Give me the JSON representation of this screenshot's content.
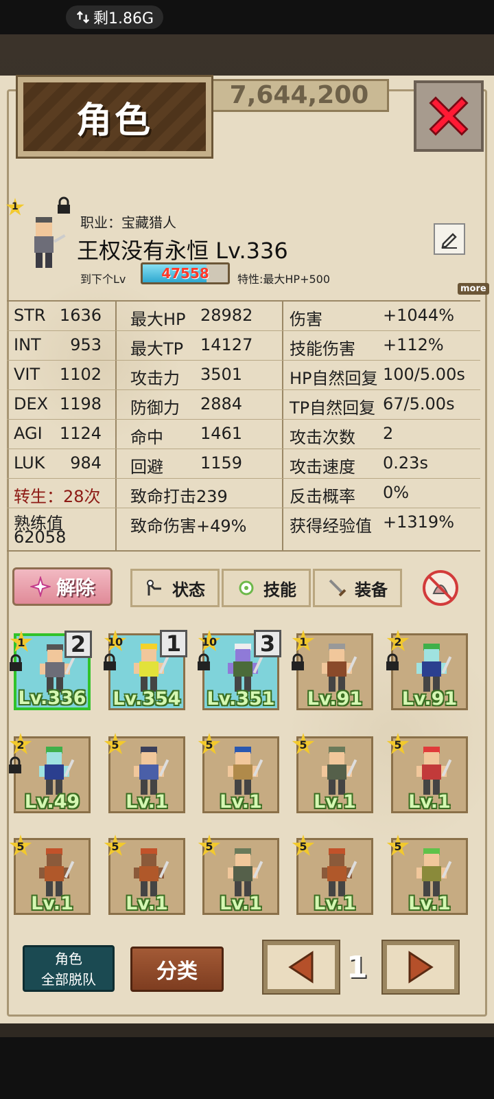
{
  "status_bar": {
    "data_remaining": "剩1.86G"
  },
  "header": {
    "title": "角色",
    "gold": "7,644,200"
  },
  "character": {
    "star_rank": "1",
    "job_label": "职业：宝藏猎人",
    "name": "王权没有永恒 Lv.336",
    "next_lv_label": "到下个Lv",
    "exp_value": "47558",
    "exp_fill_fraction": 0.75,
    "trait": "特性:最大HP+500",
    "more_label": "more"
  },
  "stats": {
    "rows": [
      {
        "c1": "STR",
        "v1": "1636",
        "c2": "最大HP",
        "v2": "28982",
        "c3": "伤害",
        "v3": "+1044%"
      },
      {
        "c1": "INT",
        "v1": "953",
        "c2": "最大TP",
        "v2": "14127",
        "c3": "技能伤害",
        "v3": "+112%"
      },
      {
        "c1": "VIT",
        "v1": "1102",
        "c2": "攻击力",
        "v2": "3501",
        "c3": "HP自然回复",
        "v3": "100/5.00s"
      },
      {
        "c1": "DEX",
        "v1": "1198",
        "c2": "防御力",
        "v2": "2884",
        "c3": "TP自然回复",
        "v3": "67/5.00s"
      },
      {
        "c1": "AGI",
        "v1": "1124",
        "c2": "命中",
        "v2": "1461",
        "c3": "攻击次数",
        "v3": "2"
      },
      {
        "c1": "LUK",
        "v1": "984",
        "c2": "回避",
        "v2": "1159",
        "c3": "攻击速度",
        "v3": "0.23s"
      },
      {
        "c1": "转生：28次",
        "v1": "",
        "c2": "致命打击239",
        "v2": "",
        "c3": "反击概率",
        "v3": "0%"
      }
    ],
    "mastery_label": "熟练值",
    "mastery_value": "62058",
    "crit_damage": "致命伤害+49%",
    "exp_gain_label": "获得经验值",
    "exp_gain_value": "+1319%"
  },
  "tabs": {
    "release": "解除",
    "status": "状态",
    "skills": "技能",
    "equipment": "装备"
  },
  "roster": [
    {
      "stars": "1",
      "level": "Lv.336",
      "party": "2",
      "locked": true,
      "active": true,
      "selected": true,
      "hair": "#555",
      "body": "#6d6d78",
      "skin": "#f1c79b"
    },
    {
      "stars": "10",
      "level": "Lv.354",
      "party": "1",
      "locked": true,
      "active": true,
      "selected": false,
      "hair": "#f4d22a",
      "body": "#e2e23a",
      "skin": "#f1c79b"
    },
    {
      "stars": "10",
      "level": "Lv.351",
      "party": "3",
      "locked": true,
      "active": true,
      "selected": false,
      "hair": "#eee",
      "body": "#4b6b3a",
      "skin": "#8f7ad8"
    },
    {
      "stars": "1",
      "level": "Lv.91",
      "party": "",
      "locked": true,
      "active": false,
      "selected": false,
      "hair": "#999",
      "body": "#8a4a2a",
      "skin": "#f1c79b"
    },
    {
      "stars": "2",
      "level": "Lv.91",
      "party": "",
      "locked": true,
      "active": false,
      "selected": false,
      "hair": "#3fb04a",
      "body": "#2b3f8f",
      "skin": "#9fe2e0"
    },
    {
      "stars": "2",
      "level": "Lv.49",
      "party": "",
      "locked": true,
      "active": false,
      "selected": false,
      "hair": "#3fb04a",
      "body": "#2b3f8f",
      "skin": "#9fe2e0"
    },
    {
      "stars": "5",
      "level": "Lv.1",
      "party": "",
      "locked": false,
      "active": false,
      "selected": false,
      "hair": "#3b3f5a",
      "body": "#4a5fa8",
      "skin": "#f1c79b"
    },
    {
      "stars": "5",
      "level": "Lv.1",
      "party": "",
      "locked": false,
      "active": false,
      "selected": false,
      "hair": "#2a58b0",
      "body": "#b08a4a",
      "skin": "#f1c79b"
    },
    {
      "stars": "5",
      "level": "Lv.1",
      "party": "",
      "locked": false,
      "active": false,
      "selected": false,
      "hair": "#6a7a5a",
      "body": "#55604a",
      "skin": "#f1c79b"
    },
    {
      "stars": "5",
      "level": "Lv.1",
      "party": "",
      "locked": false,
      "active": false,
      "selected": false,
      "hair": "#e03a3a",
      "body": "#c23a3a",
      "skin": "#f1c79b"
    },
    {
      "stars": "5",
      "level": "Lv.1",
      "party": "",
      "locked": false,
      "active": false,
      "selected": false,
      "hair": "#c2522a",
      "body": "#b0582a",
      "skin": "#8b5a3a"
    },
    {
      "stars": "5",
      "level": "Lv.1",
      "party": "",
      "locked": false,
      "active": false,
      "selected": false,
      "hair": "#c2522a",
      "body": "#b0582a",
      "skin": "#8b5a3a"
    },
    {
      "stars": "5",
      "level": "Lv.1",
      "party": "",
      "locked": false,
      "active": false,
      "selected": false,
      "hair": "#6a7a5a",
      "body": "#55604a",
      "skin": "#f1c79b"
    },
    {
      "stars": "5",
      "level": "Lv.1",
      "party": "",
      "locked": false,
      "active": false,
      "selected": false,
      "hair": "#c2522a",
      "body": "#b0582a",
      "skin": "#8b5a3a"
    },
    {
      "stars": "5",
      "level": "Lv.1",
      "party": "",
      "locked": false,
      "active": false,
      "selected": false,
      "hair": "#5fc24a",
      "body": "#8a8a3a",
      "skin": "#f1c79b"
    }
  ],
  "bottom": {
    "dismiss_line1": "角色",
    "dismiss_line2": "全部脱队",
    "sort": "分类",
    "page": "1"
  },
  "colors": {
    "accent_green": "#32c22a",
    "level_text": "#d5f7b2",
    "exp_text": "#ff3a2b"
  }
}
